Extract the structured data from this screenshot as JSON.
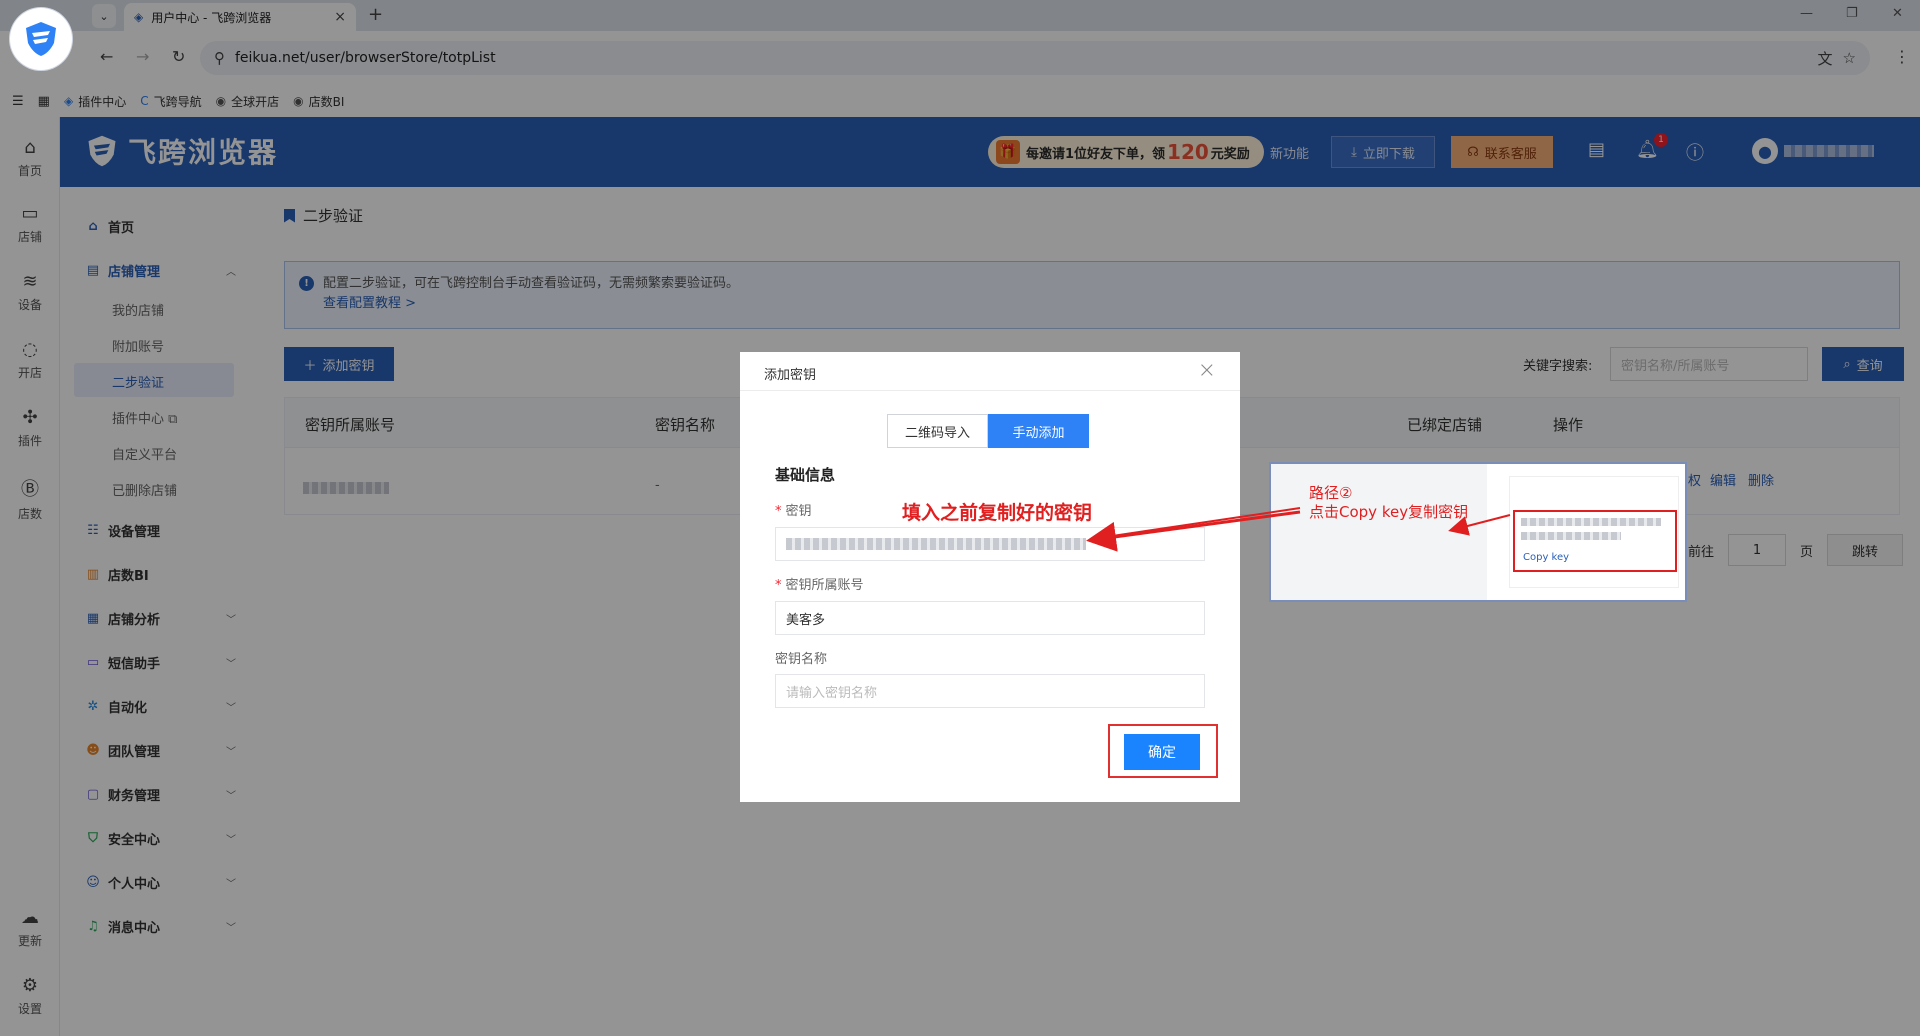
{
  "browser": {
    "tab_title": "用户中心 - 飞跨浏览器",
    "url": "feikua.net/user/browserStore/totpList",
    "bookmarks": [
      "插件中心",
      "飞跨导航",
      "全球开店",
      "店数BI"
    ]
  },
  "header": {
    "logo_text": "飞跨浏览器",
    "invite_prefix": "每邀请1位好友下单，领",
    "invite_amount": "120",
    "invite_suffix": "元奖励",
    "new_feature": "新功能",
    "download": "立即下载",
    "service": "联系客服",
    "bell_count": "1"
  },
  "rail": [
    "首页",
    "店铺",
    "设备",
    "开店",
    "插件",
    "店数",
    "更新",
    "设置"
  ],
  "sidebar": {
    "items": [
      {
        "label": "首页"
      },
      {
        "label": "店铺管理"
      },
      {
        "label": "设备管理"
      },
      {
        "label": "店数BI"
      },
      {
        "label": "店铺分析"
      },
      {
        "label": "短信助手"
      },
      {
        "label": "自动化"
      },
      {
        "label": "团队管理"
      },
      {
        "label": "财务管理"
      },
      {
        "label": "安全中心"
      },
      {
        "label": "个人中心"
      },
      {
        "label": "消息中心"
      }
    ],
    "sub_items": [
      "我的店铺",
      "附加账号",
      "二步验证",
      "插件中心",
      "自定义平台",
      "已删除店铺"
    ]
  },
  "page": {
    "title": "二步验证",
    "tip": "配置二步验证，可在飞跨控制台手动查看验证码，无需频繁索要验证码。",
    "tip_link": "查看配置教程 >",
    "add_button": "添加密钥",
    "keyword_label": "关键字搜索:",
    "keyword_placeholder": "密钥名称/所属账号",
    "query_button": "查询",
    "columns": [
      "密钥所属账号",
      "密钥名称",
      "已绑定店铺",
      "操作"
    ],
    "row_name": "-",
    "ops": [
      "权",
      "编辑",
      "删除"
    ],
    "pager": {
      "goto": "前往",
      "page": "1",
      "unit": "页",
      "jump": "跳转"
    }
  },
  "modal": {
    "title": "添加密钥",
    "tabs": [
      "二维码导入",
      "手动添加"
    ],
    "section": "基础信息",
    "field_secret_label": "密钥",
    "field_account_label": "密钥所属账号",
    "field_account_value": "美客多",
    "field_name_label": "密钥名称",
    "field_name_placeholder": "请输入密钥名称",
    "confirm": "确定"
  },
  "annotations": {
    "fill_hint": "填入之前复制好的密钥",
    "path_line1": "路径②",
    "path_line2": "点击Copy key复制密钥",
    "copy_key": "Copy key"
  }
}
